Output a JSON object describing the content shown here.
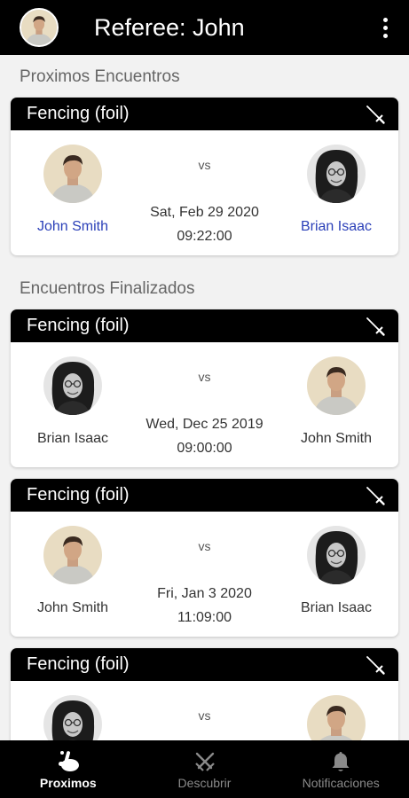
{
  "appbar": {
    "title": "Referee: John"
  },
  "sections": {
    "upcoming_title": "Proximos Encuentros",
    "finished_title": "Encuentros Finalizados"
  },
  "upcoming": [
    {
      "sport": "Fencing (foil)",
      "player1": "John Smith",
      "player2": "Brian Isaac",
      "vs": "vs",
      "date": "Sat, Feb 29 2020",
      "time": "09:22:00"
    }
  ],
  "finished": [
    {
      "sport": "Fencing (foil)",
      "player1": "Brian Isaac",
      "player2": "John Smith",
      "vs": "vs",
      "date": "Wed, Dec 25 2019",
      "time": "09:00:00"
    },
    {
      "sport": "Fencing (foil)",
      "player1": "John Smith",
      "player2": "Brian Isaac",
      "vs": "vs",
      "date": "Fri, Jan 3 2020",
      "time": "11:09:00"
    },
    {
      "sport": "Fencing (foil)",
      "vs": "vs"
    }
  ],
  "nav": {
    "items": [
      {
        "label": "Proximos",
        "icon": "hand-pointer-icon",
        "active": true
      },
      {
        "label": "Descubrir",
        "icon": "crossed-swords-icon",
        "active": false
      },
      {
        "label": "Notificaciones",
        "icon": "bell-icon",
        "active": false
      }
    ]
  },
  "colors": {
    "bar": "#000000",
    "link": "#2a3fb8",
    "background": "#f2f2f2"
  }
}
